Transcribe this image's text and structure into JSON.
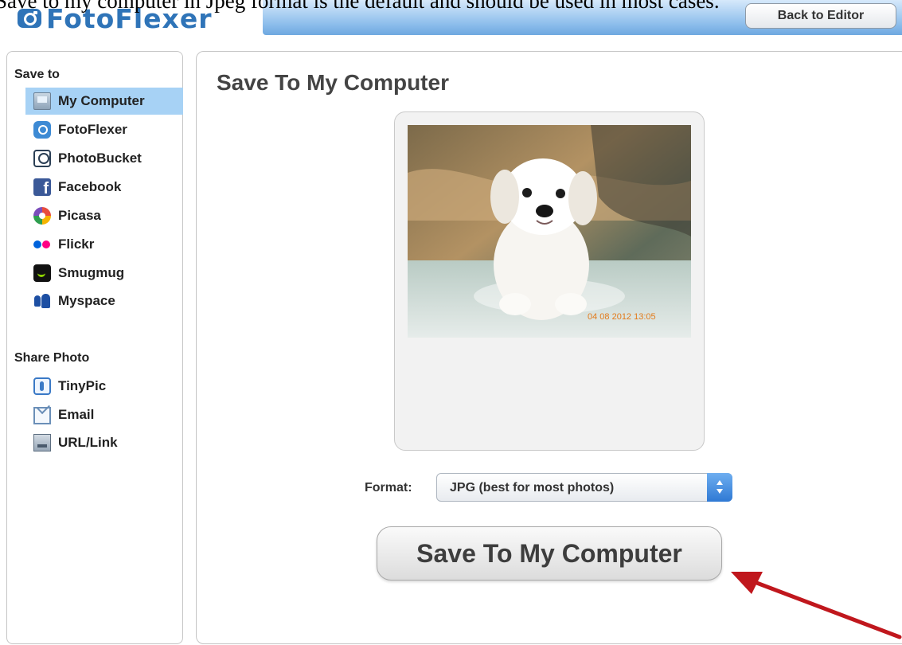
{
  "caption": "Save to my computer in Jpeg format is the default and should be used in most cases.",
  "app": {
    "logo_text": "FotoFlexer",
    "back_button": "Back to Editor"
  },
  "sidebar": {
    "save_to_title": "Save to",
    "save_to_items": [
      {
        "label": "My Computer",
        "icon": "computer-icon",
        "selected": true
      },
      {
        "label": "FotoFlexer",
        "icon": "fotoflexer-icon"
      },
      {
        "label": "PhotoBucket",
        "icon": "photobucket-icon"
      },
      {
        "label": "Facebook",
        "icon": "facebook-icon"
      },
      {
        "label": "Picasa",
        "icon": "picasa-icon"
      },
      {
        "label": "Flickr",
        "icon": "flickr-icon"
      },
      {
        "label": "Smugmug",
        "icon": "smugmug-icon"
      },
      {
        "label": "Myspace",
        "icon": "myspace-icon"
      }
    ],
    "share_title": "Share Photo",
    "share_items": [
      {
        "label": "TinyPic",
        "icon": "tinypic-icon"
      },
      {
        "label": "Email",
        "icon": "email-icon"
      },
      {
        "label": "URL/Link",
        "icon": "url-link-icon"
      }
    ]
  },
  "main": {
    "title": "Save To My Computer",
    "photo_timestamp": "04 08 2012 13:05",
    "format_label": "Format:",
    "format_value": "JPG (best for most photos)",
    "save_button": "Save To My Computer"
  },
  "colors": {
    "accent": "#2f74b8",
    "selected_row": "#a7d2f5",
    "arrow": "#c0171d"
  }
}
